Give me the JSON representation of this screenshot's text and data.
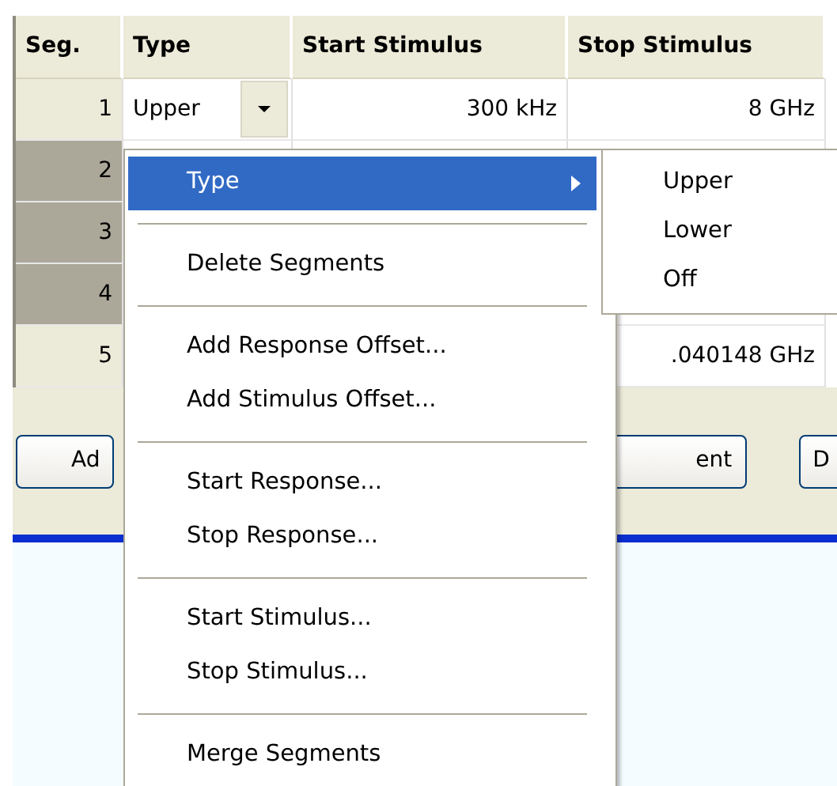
{
  "table": {
    "columns": [
      "Seg.",
      "Type",
      "Start Stimulus",
      "Stop Stimulus"
    ],
    "rows": [
      {
        "seg": "1",
        "selected": false,
        "type": "Upper",
        "start": "300 kHz",
        "stop": "8 GHz"
      },
      {
        "seg": "2",
        "selected": true
      },
      {
        "seg": "3",
        "selected": true
      },
      {
        "seg": "4",
        "selected": true
      },
      {
        "seg": "5",
        "selected": false,
        "stop": ".040148 GHz"
      }
    ]
  },
  "buttons": [
    "Ad",
    "ent",
    "D"
  ],
  "context_menu": {
    "items": [
      {
        "kind": "item",
        "label": "Type",
        "selected": true,
        "submenu": true
      },
      {
        "kind": "separator"
      },
      {
        "kind": "item",
        "label": "Delete Segments",
        "selected": false,
        "submenu": false
      },
      {
        "kind": "separator"
      },
      {
        "kind": "item",
        "label": "Add Response Offset...",
        "selected": false,
        "submenu": false
      },
      {
        "kind": "item",
        "label": "Add Stimulus Offset...",
        "selected": false,
        "submenu": false
      },
      {
        "kind": "separator"
      },
      {
        "kind": "item",
        "label": "Start Response...",
        "selected": false,
        "submenu": false
      },
      {
        "kind": "item",
        "label": "Stop Response...",
        "selected": false,
        "submenu": false
      },
      {
        "kind": "separator"
      },
      {
        "kind": "item",
        "label": "Start Stimulus...",
        "selected": false,
        "submenu": false
      },
      {
        "kind": "item",
        "label": "Stop Stimulus...",
        "selected": false,
        "submenu": false
      },
      {
        "kind": "separator"
      },
      {
        "kind": "item",
        "label": "Merge Segments",
        "selected": false,
        "submenu": false
      }
    ]
  },
  "submenu": {
    "items": [
      "Upper",
      "Lower",
      "Off"
    ]
  }
}
